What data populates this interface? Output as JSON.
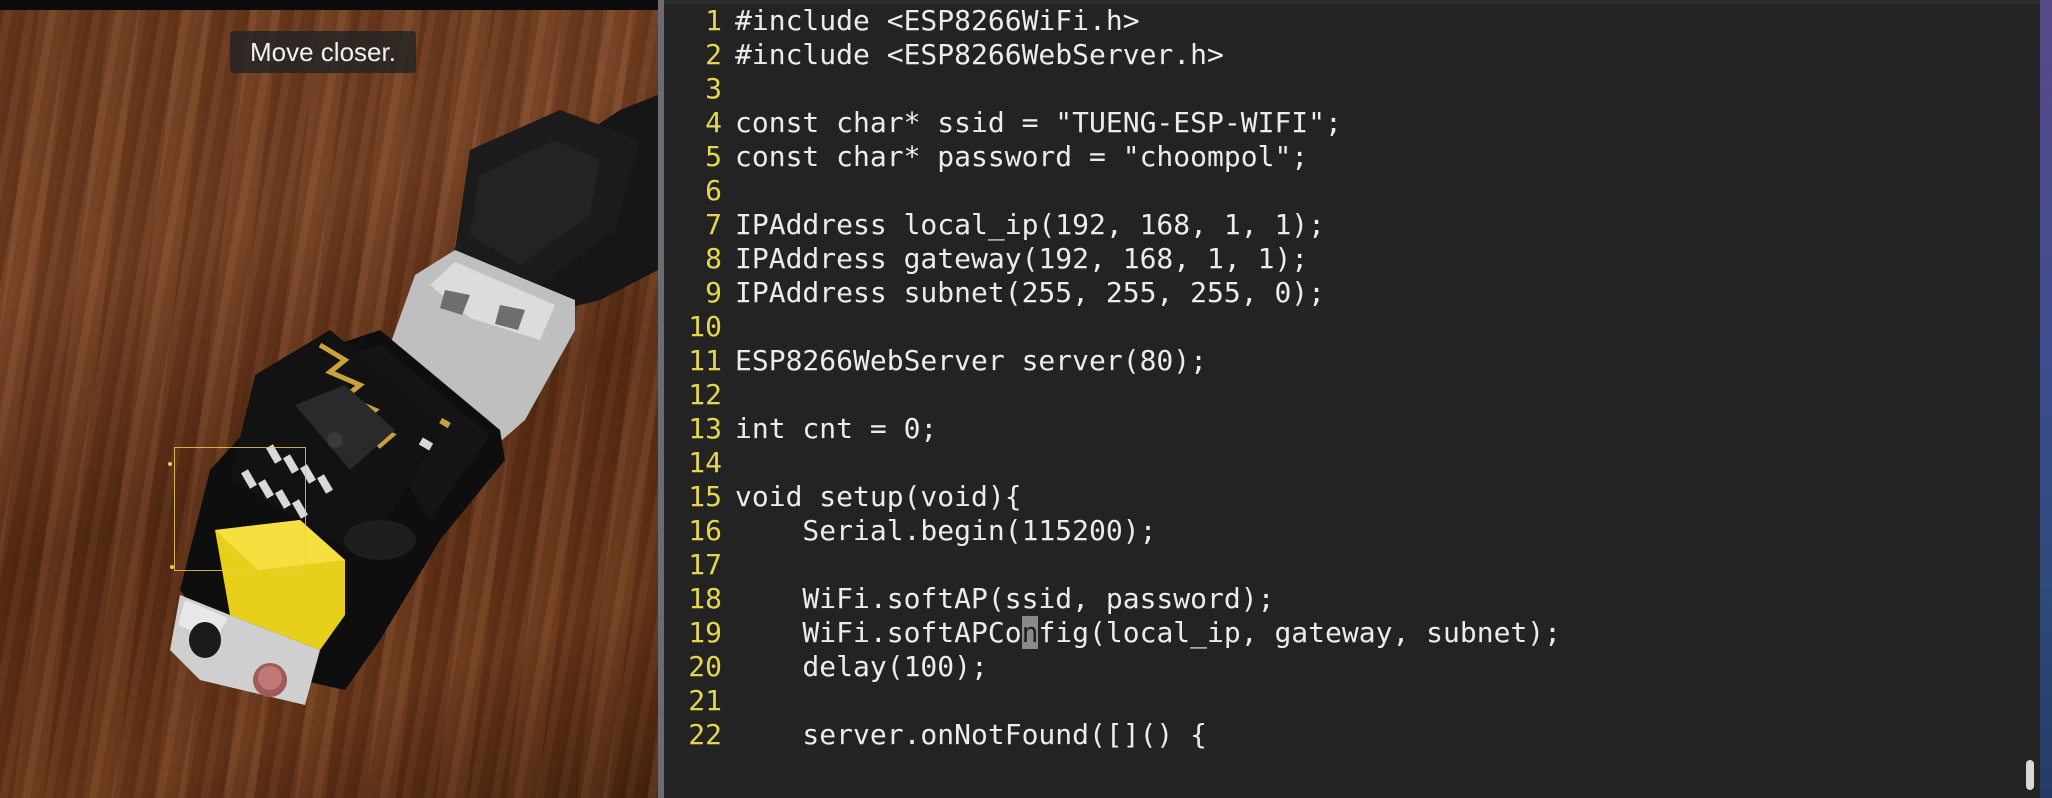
{
  "camera": {
    "hint": "Move closer."
  },
  "editor": {
    "lines": [
      {
        "n": "1",
        "code": "#include <ESP8266WiFi.h>"
      },
      {
        "n": "2",
        "code": "#include <ESP8266WebServer.h>"
      },
      {
        "n": "3",
        "code": ""
      },
      {
        "n": "4",
        "code": "const char* ssid = \"TUENG-ESP-WIFI\";"
      },
      {
        "n": "5",
        "code": "const char* password = \"choompol\";"
      },
      {
        "n": "6",
        "code": ""
      },
      {
        "n": "7",
        "code": "IPAddress local_ip(192, 168, 1, 1);"
      },
      {
        "n": "8",
        "code": "IPAddress gateway(192, 168, 1, 1);"
      },
      {
        "n": "9",
        "code": "IPAddress subnet(255, 255, 255, 0);"
      },
      {
        "n": "10",
        "code": ""
      },
      {
        "n": "11",
        "code": "ESP8266WebServer server(80);"
      },
      {
        "n": "12",
        "code": ""
      },
      {
        "n": "13",
        "code": "int cnt = 0;"
      },
      {
        "n": "14",
        "code": ""
      },
      {
        "n": "15",
        "code": "void setup(void){"
      },
      {
        "n": "16",
        "code": "    Serial.begin(115200);"
      },
      {
        "n": "17",
        "code": ""
      },
      {
        "n": "18",
        "code": "    WiFi.softAP(ssid, password);"
      },
      {
        "n": "19",
        "code_pre": "    WiFi.softAPCo",
        "code_cursor": "n",
        "code_post": "fig(local_ip, gateway, subnet);"
      },
      {
        "n": "20",
        "code": "    delay(100);"
      },
      {
        "n": "21",
        "code": ""
      },
      {
        "n": "22",
        "code": "    server.onNotFound([]() {"
      }
    ]
  },
  "colors": {
    "line_number": "#e5d64a",
    "code_text": "#ececec",
    "editor_bg": "#232323"
  }
}
